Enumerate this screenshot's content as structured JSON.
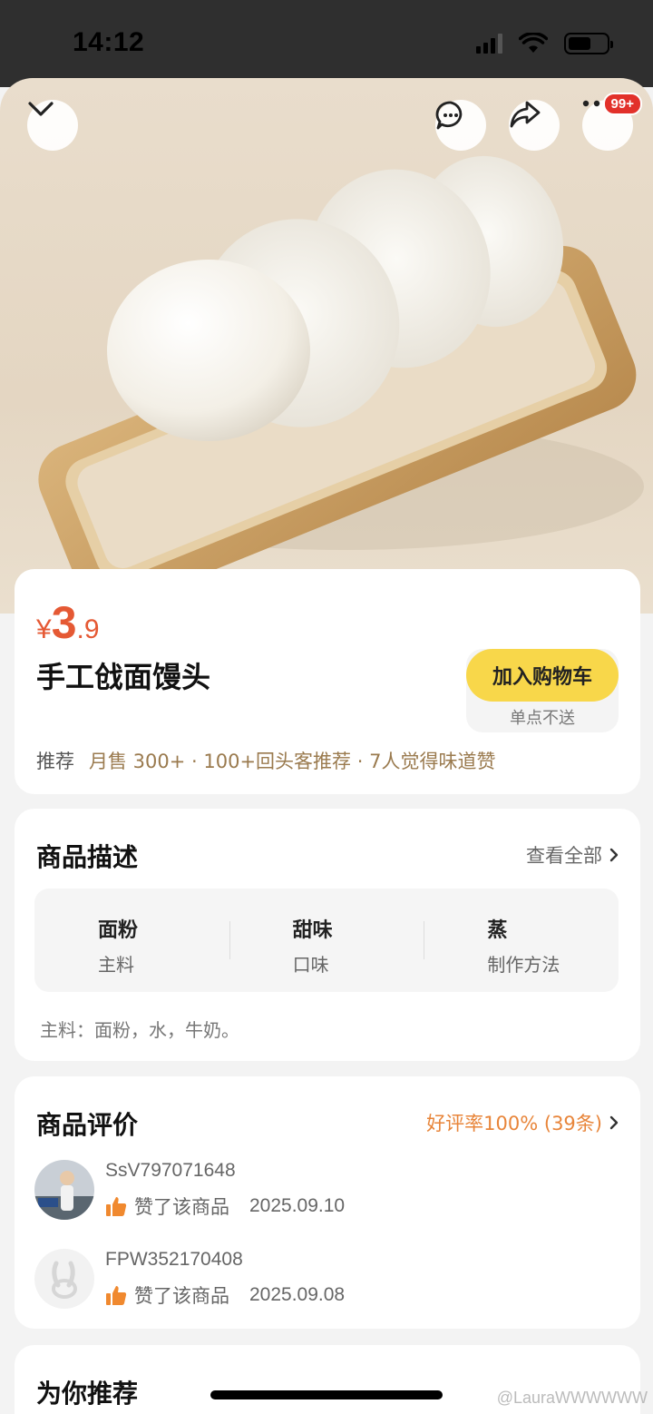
{
  "status_bar": {
    "time": "14:12"
  },
  "hero": {
    "notification_badge": "99+"
  },
  "product": {
    "price_currency": "¥",
    "price_integer": "3",
    "price_decimal": ".9",
    "name": "手工戗面馒头",
    "add_to_cart_label": "加入购物车",
    "add_to_cart_note": "单点不送",
    "tags_label": "推荐",
    "tags_text": "月售 300+ · 100+回头客推荐 · 7人觉得味道赞"
  },
  "description": {
    "title": "商品描述",
    "more_label": "查看全部",
    "attributes": [
      {
        "value": "面粉",
        "key": "主料"
      },
      {
        "value": "甜味",
        "key": "口味"
      },
      {
        "value": "蒸",
        "key": "制作方法"
      }
    ],
    "ingredients": "主料：面粉，水，牛奶。"
  },
  "reviews": {
    "title": "商品评价",
    "rating_label": "好评率100% (39条)",
    "items": [
      {
        "user": "SsV797071648",
        "action": "赞了该商品",
        "date": "2025.09.10"
      },
      {
        "user": "FPW352170408",
        "action": "赞了该商品",
        "date": "2025.09.08"
      }
    ]
  },
  "recommend": {
    "title": "为你推荐"
  },
  "watermark": "@LauraWWWWWW",
  "colors": {
    "price": "#e55934",
    "accent_yellow": "#f8d74a",
    "tag_brown": "#9a7a4e",
    "rating_orange": "#e8853a",
    "badge_red": "#e2312a"
  }
}
